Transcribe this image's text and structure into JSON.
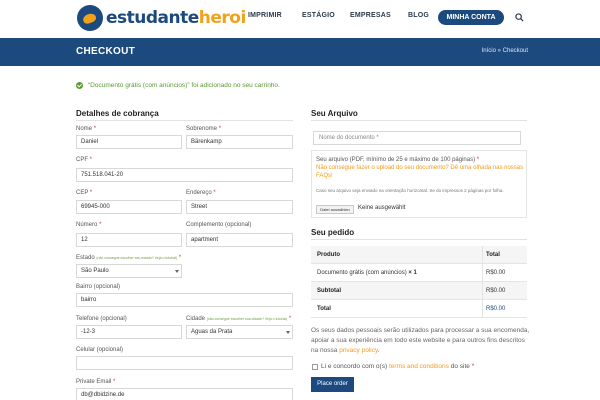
{
  "header": {
    "logo_part1": "estudante",
    "logo_part2": "heroi",
    "nav": [
      "IMPRIMIR",
      "ESTÁGIO",
      "EMPRESAS",
      "BLOG"
    ],
    "nav_button": "MINHA CONTA",
    "search_icon": "search-icon"
  },
  "titlebar": {
    "title": "CHECKOUT",
    "breadcrumb": "Início » Checkout"
  },
  "notice": {
    "text": "“Documento grátis (com anúncios)” foi adicionado no seu carrinho.",
    "color": "#5a9a2f"
  },
  "billing": {
    "heading": "Detalhes de cobrança",
    "nome_label": "Nome",
    "nome_value": "Daniel",
    "sobrenome_label": "Sobrenome",
    "sobrenome_value": "Bärenkamp",
    "cpf_label": "CPF",
    "cpf_value": "751.518.041-20",
    "cep_label": "CEP",
    "cep_value": "69945-000",
    "endereco_label": "Endereço",
    "endereco_value": "Street",
    "numero_label": "Número",
    "numero_value": "12",
    "complemento_label": "Complemento (opcional)",
    "complemento_value": "apartment",
    "estado_label": "Estado",
    "estado_note": "(não consegue escolher seu estado? Veja o tutorial)",
    "estado_value": "São Paulo",
    "bairro_label": "Bairro (opcional)",
    "bairro_value": "bairro",
    "telefone_label": "Telefone (opcional)",
    "telefone_value": "-12-3",
    "cidade_label": "Cidade",
    "cidade_note": "(não consegue escolher sua cidade? Veja o tutorial)",
    "cidade_value": "Aguas da Prata",
    "celular_label": "Celular (opcional)",
    "celular_value": "",
    "email_label": "Private Email",
    "email_value": "db@dbidzine.de"
  },
  "arquivo": {
    "heading": "Seu Arquivo",
    "doc_placeholder": "Nome do documento *",
    "upload_line1": "Seu arquivo (PDF, mínimo de 25 e máximo de 100 páginas)",
    "upload_line2": "Não consegue fazer o upload do seu documento? Dê uma olhada nas nossas FAQs!",
    "upload_note": "Caso seu arquivo seja enviado na orientação horizontal. Se do impressos 2 páginas por folha.",
    "file_button": "Datei auswählen",
    "file_status": "Keine ausgewählt"
  },
  "pedido": {
    "heading": "Seu pedido",
    "col_product": "Produto",
    "col_total": "Total",
    "item_name": "Documento grátis (com anúncios)",
    "item_qty": "× 1",
    "item_total": "R$0.00",
    "subtotal_label": "Subtotal",
    "subtotal_value": "R$0.00",
    "total_label": "Total",
    "total_value": "R$0.00"
  },
  "privacy": {
    "text": "Os seus dados pessoais serão utilizados para processar a sua encomenda, apoiar a sua experiência em todo este website e para outros fins descritos na nossa",
    "link": "privacy policy",
    "end": "."
  },
  "terms": {
    "prefix": "Li e concordo com o(s)",
    "link": "terms and conditions",
    "suffix": "do site"
  },
  "place_order": "Place order",
  "colors": {
    "brand": "#1c4a7e",
    "accent": "#f2a21a",
    "success": "#5a9a2f"
  }
}
